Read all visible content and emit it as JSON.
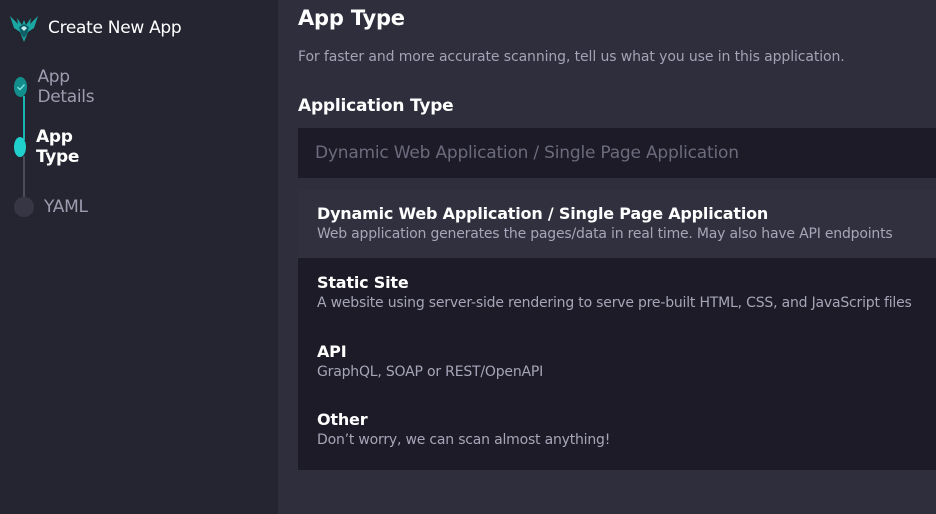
{
  "sidebar": {
    "brand_title": "Create New App",
    "logo_icon": "hawk-logo-icon",
    "steps": [
      {
        "label": "App Details",
        "state": "done",
        "icon": "check-icon"
      },
      {
        "label": "App Type",
        "state": "active"
      },
      {
        "label": "YAML",
        "state": "todo"
      }
    ]
  },
  "main": {
    "title": "App Type",
    "subtitle": "For faster and more accurate scanning, tell us what you use in this application.",
    "section_label": "Application Type",
    "select": {
      "value": "Dynamic Web Application / Single Page Application",
      "open": true
    },
    "options": [
      {
        "title": "Dynamic Web Application / Single Page Application",
        "description": "Web application generates the pages/data in real time. May also have API endpoints",
        "selected": true
      },
      {
        "title": "Static Site",
        "description": "A website using server-side rendering to serve pre-built HTML, CSS, and JavaScript files",
        "selected": false
      },
      {
        "title": "API",
        "description": "GraphQL, SOAP or REST/OpenAPI",
        "selected": false
      },
      {
        "title": "Other",
        "description": "Don’t worry, we can scan almost anything!",
        "selected": false
      }
    ]
  },
  "colors": {
    "accent": "#1fd0cc",
    "accent_done": "#128f8c",
    "background": "#2e2e3d",
    "sidebar": "#252532",
    "dropdown": "#1c1b27"
  }
}
